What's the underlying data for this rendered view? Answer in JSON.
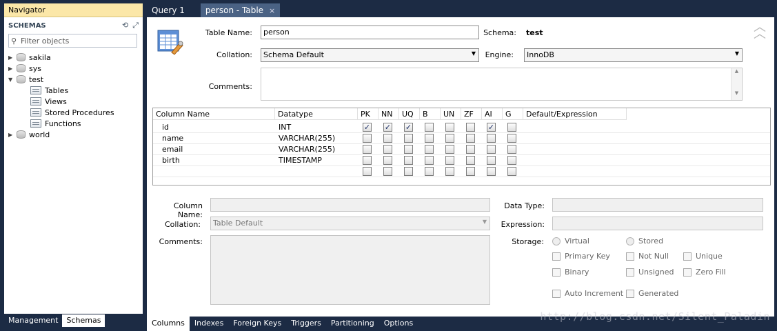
{
  "navigator": {
    "title": "Navigator",
    "schemas_label": "SCHEMAS",
    "filter_placeholder": "Filter objects",
    "tree": {
      "sakila": "sakila",
      "sys": "sys",
      "test": "test",
      "tables": "Tables",
      "views": "Views",
      "procs": "Stored Procedures",
      "funcs": "Functions",
      "world": "world"
    },
    "bottom_tabs": [
      "Management",
      "Schemas"
    ]
  },
  "editor_tabs": {
    "query": "Query 1",
    "table": "person - Table",
    "close": "×"
  },
  "form": {
    "table_name_label": "Table Name:",
    "table_name_value": "person",
    "schema_label": "Schema:",
    "schema_value": "test",
    "collation_label": "Collation:",
    "collation_value": "Schema Default",
    "engine_label": "Engine:",
    "engine_value": "InnoDB",
    "comments_label": "Comments:"
  },
  "grid": {
    "headers": [
      "Column Name",
      "Datatype",
      "PK",
      "NN",
      "UQ",
      "B",
      "UN",
      "ZF",
      "AI",
      "G",
      "Default/Expression"
    ],
    "rows": [
      {
        "name": "id",
        "type": "INT",
        "flags": [
          true,
          true,
          true,
          false,
          false,
          false,
          true,
          false
        ]
      },
      {
        "name": "name",
        "type": "VARCHAR(255)",
        "flags": [
          false,
          false,
          false,
          false,
          false,
          false,
          false,
          false
        ]
      },
      {
        "name": "email",
        "type": "VARCHAR(255)",
        "flags": [
          false,
          false,
          false,
          false,
          false,
          false,
          false,
          false
        ]
      },
      {
        "name": "birth",
        "type": "TIMESTAMP",
        "flags": [
          false,
          false,
          false,
          false,
          false,
          false,
          false,
          false
        ]
      },
      {
        "name": "",
        "type": "",
        "flags": [
          false,
          false,
          false,
          false,
          false,
          false,
          false,
          false
        ]
      }
    ]
  },
  "detail": {
    "column_name_label": "Column Name:",
    "data_type_label": "Data Type:",
    "collation_label": "Collation:",
    "collation_value": "Table Default",
    "expression_label": "Expression:",
    "comments_label": "Comments:",
    "storage_label": "Storage:",
    "virtual": "Virtual",
    "stored": "Stored",
    "primary_key": "Primary Key",
    "not_null": "Not Null",
    "unique": "Unique",
    "binary": "Binary",
    "unsigned": "Unsigned",
    "zero_fill": "Zero Fill",
    "auto_increment": "Auto Increment",
    "generated": "Generated"
  },
  "bottom_tabs": [
    "Columns",
    "Indexes",
    "Foreign Keys",
    "Triggers",
    "Partitioning",
    "Options"
  ],
  "watermark": "http://blog.csdn.net/Silent_Paladin",
  "colors": {
    "background": "#1c2b44",
    "navigator_title": "#fbe7a8",
    "active_tab": "#4a6284",
    "check": "#1b2e66"
  }
}
